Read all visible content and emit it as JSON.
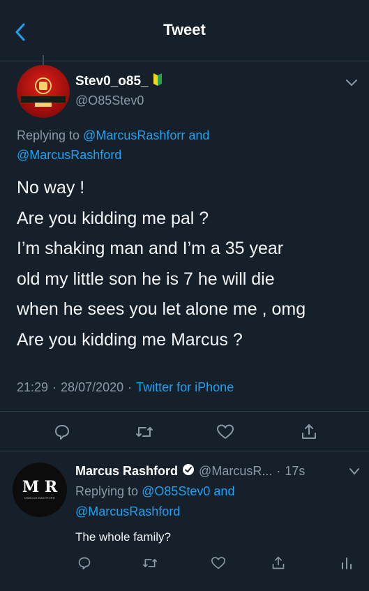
{
  "header": {
    "title": "Tweet"
  },
  "tweet": {
    "name": "Stev0_o85_",
    "handle": "@O85Stev0",
    "replying_prefix": "Replying to",
    "replying_to_1": "@MarcusRashforr",
    "replying_and": "and",
    "replying_to_2": "@MarcusRashford",
    "lines": [
      "No way !",
      "Are you kidding me pal ?",
      "I’m shaking man and I’m a 35 year",
      "old my little son he is 7 he will die",
      "when he sees you let alone me , omg",
      "Are you kidding me Marcus ?"
    ],
    "time": "21:29",
    "separator": "·",
    "date": "28/07/2020",
    "source": "Twitter for iPhone",
    "avatar_text": "MANCHESTER UNITED"
  },
  "reply": {
    "name": "Marcus Rashford",
    "handle": "@MarcusR...",
    "separator": "·",
    "age": "17s",
    "replying_prefix": "Replying to",
    "replying_to_1": "@O85Stev0",
    "replying_and": "and",
    "replying_to_2": "@MarcusRashford",
    "text": "The whole family?",
    "avatar_monogram": "M R",
    "avatar_caption": "MARCUS RASHFORD"
  },
  "icons": {
    "back": "chevron-left-icon",
    "caret": "chevron-down-icon",
    "reply": "comment-icon",
    "retweet": "retweet-icon",
    "like": "heart-icon",
    "share": "share-icon",
    "analytics": "analytics-icon",
    "verified": "verified-badge-icon",
    "beginner": "beginner-badge-icon"
  },
  "colors": {
    "background": "#15202b",
    "accent": "#1da1f2",
    "muted": "#8b98a5",
    "divider": "#2b3a48"
  }
}
